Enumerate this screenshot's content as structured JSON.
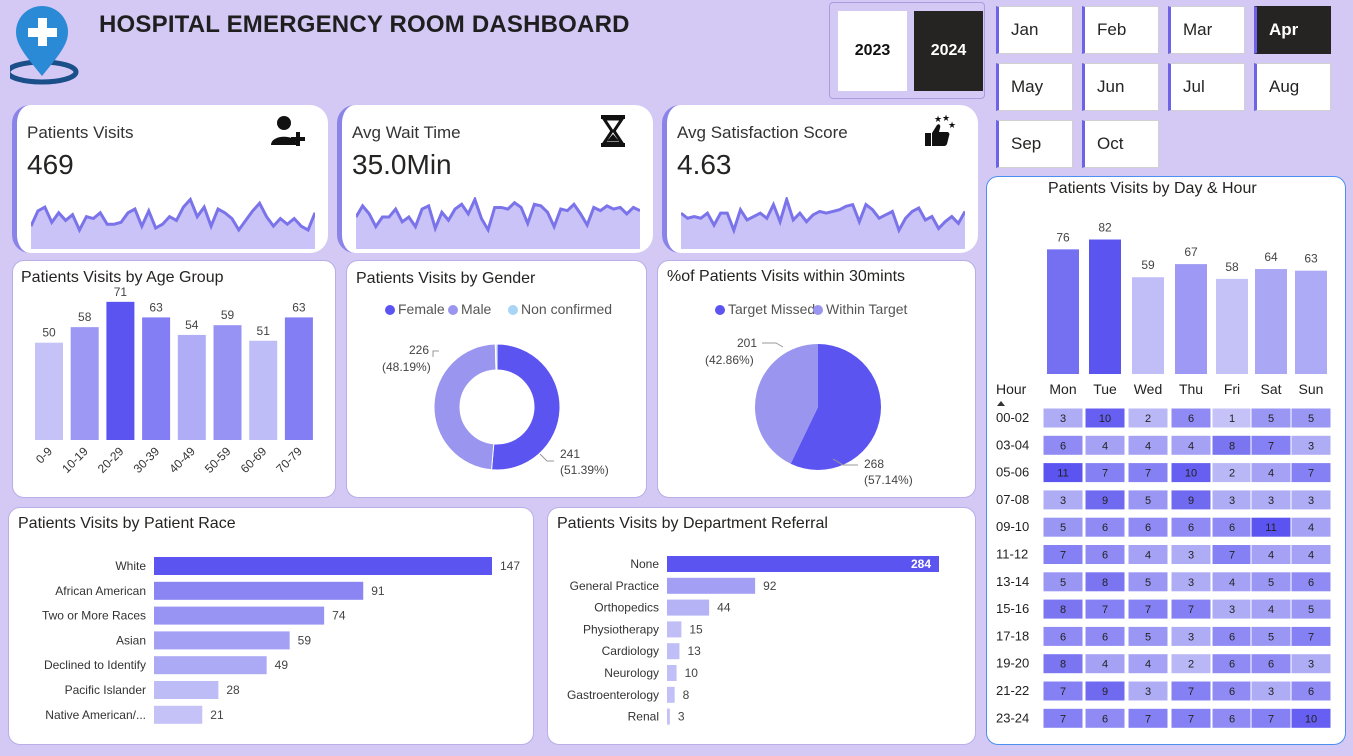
{
  "header": {
    "title": "HOSPITAL EMERGENCY ROOM DASHBOARD",
    "years": [
      {
        "label": "2023",
        "selected": false
      },
      {
        "label": "2024",
        "selected": true
      }
    ],
    "months": [
      {
        "label": "Jan",
        "selected": false
      },
      {
        "label": "Feb",
        "selected": false
      },
      {
        "label": "Mar",
        "selected": false
      },
      {
        "label": "Apr",
        "selected": true
      },
      {
        "label": "May",
        "selected": false
      },
      {
        "label": "Jun",
        "selected": false
      },
      {
        "label": "Jul",
        "selected": false
      },
      {
        "label": "Aug",
        "selected": false
      },
      {
        "label": "Sep",
        "selected": false
      },
      {
        "label": "Oct",
        "selected": false
      }
    ]
  },
  "kpis": {
    "visits": {
      "label": "Patients Visits",
      "value": "469",
      "icon": "add-user-icon"
    },
    "wait": {
      "label": "Avg Wait Time",
      "value": "35.0Min",
      "icon": "hourglass-icon"
    },
    "satisfaction": {
      "label": "Avg Satisfaction Score",
      "value": "4.63",
      "icon": "thumbs-up-stars-icon"
    }
  },
  "colors": {
    "background": "#d4c8f4",
    "accent_dark": "#5b54f0",
    "accent_mid": "#8b84e8",
    "accent_light": "#b8b4f5",
    "selected_slicer": "#252423"
  },
  "chart_data": [
    {
      "id": "age",
      "type": "bar",
      "title": "Patients Visits by Age Group",
      "categories": [
        "0-9",
        "10-19",
        "20-29",
        "30-39",
        "40-49",
        "50-59",
        "60-69",
        "70-79"
      ],
      "values": [
        50,
        58,
        71,
        63,
        54,
        59,
        51,
        63
      ],
      "ylim": [
        0,
        80
      ]
    },
    {
      "id": "gender",
      "type": "pie",
      "variant": "donut",
      "title": "Patients Visits by Gender",
      "legend": [
        "Female",
        "Male",
        "Non confirmed"
      ],
      "values": [
        241,
        226,
        2
      ],
      "labels": [
        {
          "value": "241",
          "pct": "(51.39%)"
        },
        {
          "value": "226",
          "pct": "(48.19%)"
        }
      ],
      "legend_position": "top"
    },
    {
      "id": "target",
      "type": "pie",
      "title": "%of Patients Visits within 30mints",
      "legend": [
        "Target Missed",
        "Within Target"
      ],
      "values": [
        268,
        201
      ],
      "labels": [
        {
          "value": "268",
          "pct": "(57.14%)"
        },
        {
          "value": "201",
          "pct": "(42.86%)"
        }
      ],
      "legend_position": "top"
    },
    {
      "id": "race",
      "type": "bar",
      "orientation": "horizontal",
      "title": "Patients Visits by Patient Race",
      "categories": [
        "White",
        "African American",
        "Two or More Races",
        "Asian",
        "Declined to Identify",
        "Pacific Islander",
        "Native American/..."
      ],
      "values": [
        147,
        91,
        74,
        59,
        49,
        28,
        21
      ]
    },
    {
      "id": "dept",
      "type": "bar",
      "orientation": "horizontal",
      "title": "Patients Visits by Department Referral",
      "categories": [
        "None",
        "General Practice",
        "Orthopedics",
        "Physiotherapy",
        "Cardiology",
        "Neurology",
        "Gastroenterology",
        "Renal"
      ],
      "values": [
        284,
        92,
        44,
        15,
        13,
        10,
        8,
        3
      ]
    },
    {
      "id": "day",
      "type": "bar",
      "title": "Patients Visits by Day & Hour",
      "categories": [
        "Mon",
        "Tue",
        "Wed",
        "Thu",
        "Fri",
        "Sat",
        "Sun"
      ],
      "values": [
        76,
        82,
        59,
        67,
        58,
        64,
        63
      ]
    },
    {
      "id": "heatmap",
      "type": "heatmap",
      "row_header": "Hour",
      "columns": [
        "Mon",
        "Tue",
        "Wed",
        "Thu",
        "Fri",
        "Sat",
        "Sun"
      ],
      "rows": [
        "00-02",
        "03-04",
        "05-06",
        "07-08",
        "09-10",
        "11-12",
        "13-14",
        "15-16",
        "17-18",
        "19-20",
        "21-22",
        "23-24"
      ],
      "values": [
        [
          3,
          10,
          2,
          6,
          1,
          5,
          5
        ],
        [
          6,
          4,
          4,
          4,
          8,
          7,
          3
        ],
        [
          11,
          7,
          7,
          10,
          2,
          4,
          7
        ],
        [
          3,
          9,
          5,
          9,
          3,
          3,
          3
        ],
        [
          5,
          6,
          6,
          6,
          6,
          11,
          4
        ],
        [
          7,
          6,
          4,
          3,
          7,
          4,
          4
        ],
        [
          5,
          8,
          5,
          3,
          4,
          5,
          6
        ],
        [
          8,
          7,
          7,
          7,
          3,
          4,
          5
        ],
        [
          6,
          6,
          5,
          3,
          6,
          5,
          7
        ],
        [
          8,
          4,
          4,
          2,
          6,
          6,
          3
        ],
        [
          7,
          9,
          3,
          7,
          6,
          3,
          6
        ],
        [
          7,
          6,
          7,
          7,
          6,
          7,
          10
        ]
      ]
    },
    {
      "id": "spark-visits",
      "type": "area",
      "values": [
        12,
        20,
        22,
        14,
        19,
        15,
        18,
        10,
        17,
        16,
        19,
        13,
        13,
        14,
        19,
        21,
        12,
        20,
        11,
        13,
        17,
        15,
        22,
        26,
        17,
        22,
        12,
        21,
        19,
        16,
        10,
        15,
        20,
        24,
        17,
        12,
        16,
        13,
        16,
        12,
        10,
        19
      ]
    },
    {
      "id": "spark-wait",
      "type": "area",
      "values": [
        20,
        27,
        22,
        14,
        20,
        20,
        25,
        17,
        20,
        14,
        25,
        27,
        13,
        23,
        18,
        25,
        28,
        22,
        31,
        19,
        12,
        26,
        26,
        25,
        29,
        26,
        16,
        28,
        27,
        23,
        14,
        25,
        24,
        28,
        22,
        15,
        26,
        24,
        27,
        25,
        26,
        22,
        26,
        24
      ]
    },
    {
      "id": "spark-sat",
      "type": "area",
      "values": [
        21,
        18,
        19,
        18,
        21,
        14,
        21,
        21,
        11,
        23,
        17,
        19,
        21,
        18,
        26,
        16,
        29,
        17,
        21,
        16,
        20,
        22,
        21,
        22,
        23,
        25,
        26,
        16,
        26,
        23,
        18,
        20,
        22,
        11,
        18,
        22,
        24,
        17,
        19,
        12,
        16,
        19,
        15,
        22
      ]
    }
  ]
}
